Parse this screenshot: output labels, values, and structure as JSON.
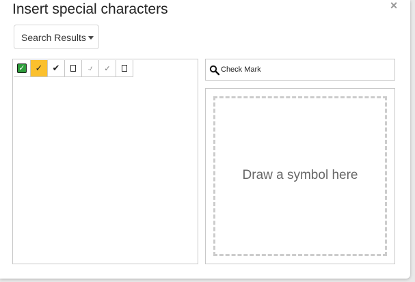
{
  "dialog": {
    "title": "Insert special characters",
    "close_glyph": "×"
  },
  "category_dropdown": {
    "selected": "Search Results"
  },
  "results": {
    "characters": [
      {
        "glyph": "✓",
        "icon": "white-heavy-check-mark-icon"
      },
      {
        "glyph": "✓",
        "icon": "check-mark-icon",
        "selected": true
      },
      {
        "glyph": "✔",
        "icon": "heavy-check-mark-icon"
      },
      {
        "glyph": "",
        "icon": "box-outline-icon"
      },
      {
        "glyph": "⍻",
        "icon": "not-check-mark-icon"
      },
      {
        "glyph": "✓",
        "icon": "light-check-mark-icon"
      },
      {
        "glyph": "",
        "icon": "box-outline-icon"
      }
    ]
  },
  "search": {
    "value": "Check Mark",
    "icon": "search-icon"
  },
  "draw": {
    "label": "Draw a symbol here"
  },
  "colors": {
    "selected_cell": "#fbc02d",
    "check_box_green": "#2e9d3b"
  }
}
